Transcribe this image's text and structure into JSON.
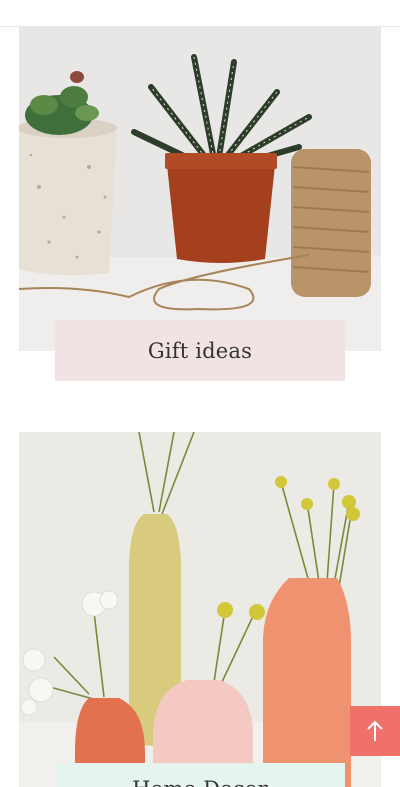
{
  "collections": [
    {
      "label": "Gift ideas",
      "label_bg": "#f1e3e4"
    },
    {
      "label": "Home Decor",
      "label_bg": "#e6f4f0"
    }
  ],
  "back_to_top": {
    "icon": "arrow-up-icon",
    "color": "#f0706a"
  }
}
